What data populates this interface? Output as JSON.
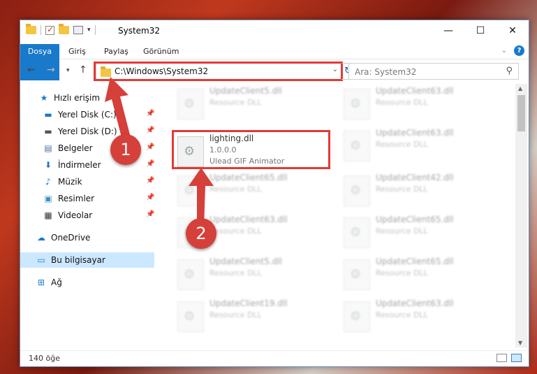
{
  "window": {
    "title": "System32",
    "controls": {
      "minimize": "—",
      "maximize": "☐",
      "close": "✕"
    }
  },
  "ribbon": {
    "tabs": [
      "Dosya",
      "Giriş",
      "Paylaş",
      "Görünüm"
    ],
    "help": "?"
  },
  "address": {
    "path": "C:\\Windows\\System32",
    "search_placeholder": "Ara: System32"
  },
  "sidebar": {
    "items": [
      {
        "label": "Hızlı erişim",
        "icon": "star-icon"
      },
      {
        "label": "Yerel Disk (C:)",
        "icon": "drive-windows-icon",
        "pinned": true
      },
      {
        "label": "Yerel Disk (D:)",
        "icon": "drive-icon",
        "pinned": true
      },
      {
        "label": "Belgeler",
        "icon": "documents-icon",
        "pinned": true
      },
      {
        "label": "İndirmeler",
        "icon": "download-icon",
        "pinned": true
      },
      {
        "label": "Müzik",
        "icon": "music-icon",
        "pinned": true
      },
      {
        "label": "Resimler",
        "icon": "pictures-icon",
        "pinned": true
      },
      {
        "label": "Videolar",
        "icon": "videos-icon",
        "pinned": true
      },
      {
        "label": "OneDrive",
        "icon": "cloud-icon"
      },
      {
        "label": "Bu bilgisayar",
        "icon": "computer-icon",
        "selected": true
      },
      {
        "label": "Ağ",
        "icon": "network-icon"
      }
    ]
  },
  "files": {
    "highlighted": {
      "name": "lighting.dll",
      "version": "1.0.0.0",
      "company": "Ulead GIF Animator"
    },
    "background": [
      {
        "name": "UpdateClient5.dll",
        "desc": "Resource DLL"
      },
      {
        "name": "UpdateClient63.dll",
        "desc": "Resource DLL"
      },
      {
        "name": "UpdateClient63.dll",
        "desc": "Resource DLL"
      },
      {
        "name": "UpdateClient65.dll",
        "desc": "Resource DLL"
      },
      {
        "name": "UpdateClient42.dll",
        "desc": "Resource DLL"
      },
      {
        "name": "UpdateClient63.dll",
        "desc": "Resource DLL"
      },
      {
        "name": "UpdateClient65.dll",
        "desc": "Resource DLL"
      },
      {
        "name": "UpdateClient5.dll",
        "desc": "Resource DLL"
      },
      {
        "name": "UpdateClient65.dll",
        "desc": "Resource DLL"
      },
      {
        "name": "UpdateClient19.dll",
        "desc": "Resource DLL"
      },
      {
        "name": "UpdateClient63.dll",
        "desc": "Resource DLL"
      }
    ]
  },
  "status": {
    "count": "140 öğe"
  },
  "callouts": {
    "one": "1",
    "two": "2"
  },
  "colors": {
    "accent": "#1979ca",
    "highlight": "#e53935",
    "badge": "#d6403a"
  }
}
